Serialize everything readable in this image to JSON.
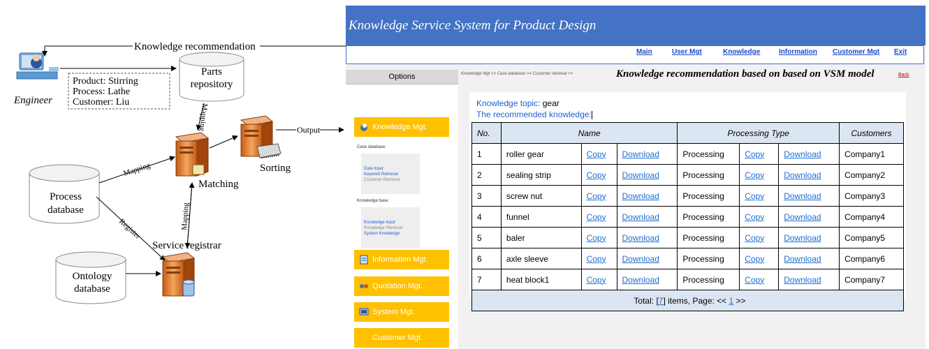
{
  "diagram": {
    "engineer_label": "Engineer",
    "knowledge_recommendation": "Knowledge recommendation",
    "query": {
      "product": "Product: Stirring",
      "process": "Process: Lathe",
      "customer": "Customer: Liu"
    },
    "parts_repository": [
      "Parts",
      "repository"
    ],
    "process_database": [
      "Process",
      "database"
    ],
    "ontology_database": [
      "Ontology",
      "database"
    ],
    "matching": "Matching",
    "sorting": "Sorting",
    "service_registrar": "Service registrar",
    "output": "Output",
    "mapping": "Mapping",
    "register": "Register"
  },
  "app": {
    "title": "Knowledge Service System for Product Design",
    "nav": [
      "Main",
      "User Mgt",
      "Knowledge",
      "Information",
      "Customer Mgt",
      "Exit"
    ],
    "options_header": "Options",
    "menu": {
      "knowledge_mgt": "Knowledge Mgt.",
      "case_database_header": "Case database:",
      "case_items": [
        "Data Input",
        "Keyword Retrieval",
        "Customer Retrieval"
      ],
      "knowledge_base_header": "Knowledge base:",
      "kb_items": [
        "Knowledge Input",
        "Knowledge Retrieval",
        "System Knowledge"
      ],
      "information_mgt": "Information Mgt.",
      "quotation_mgt": "Quotation Mgt.",
      "system_mgt": "System Mgt.",
      "customer_mgt": "Customer Mgt."
    },
    "breadcrumb": "Knowledge Mgt >> Case database >> Customer retrieval >>",
    "page_title": "Knowledge recommendation based on based on VSM model",
    "back": "Back",
    "topic_label": "Knowledge topic:",
    "topic_value": "gear",
    "recommended_label": "The recommended knowledge:",
    "table": {
      "headers": [
        "No.",
        "Name",
        "Processing Type",
        "Customers"
      ],
      "rows": [
        {
          "no": "1",
          "name": "roller gear",
          "copy": "Copy",
          "download": "Download",
          "ptype": "Processing",
          "customer": "Company1"
        },
        {
          "no": "2",
          "name": "sealing strip",
          "copy": "Copy",
          "download": "Download",
          "ptype": "Processing",
          "customer": "Company2"
        },
        {
          "no": "3",
          "name": "screw nut",
          "copy": "Copy",
          "download": "Download",
          "ptype": "Processing",
          "customer": "Company3"
        },
        {
          "no": "4",
          "name": "funnel",
          "copy": "Copy",
          "download": "Download",
          "ptype": "Processing",
          "customer": "Company4"
        },
        {
          "no": "5",
          "name": "baler",
          "copy": "Copy",
          "download": "Download",
          "ptype": "Processing",
          "customer": "Company5"
        },
        {
          "no": "6",
          "name": "axle sleeve",
          "copy": "Copy",
          "download": "Download",
          "ptype": "Processing",
          "customer": "Company6"
        },
        {
          "no": "7",
          "name": "heat block1",
          "copy": "Copy",
          "download": "Download",
          "ptype": "Processing",
          "customer": "Company7"
        }
      ],
      "footer": {
        "total_prefix": "Total: [",
        "total": "7",
        "mid": "] items, Page: << ",
        "page": "1",
        "suffix": " >>"
      }
    },
    "colors": {
      "header_blue": "#4472c4",
      "menu_yellow": "#ffc000",
      "link_blue": "#1f6fd0",
      "table_header": "#dce6f2"
    }
  }
}
